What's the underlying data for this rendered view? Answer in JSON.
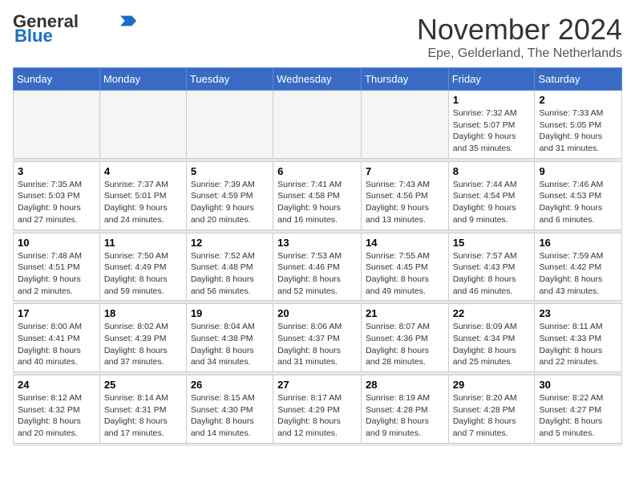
{
  "logo": {
    "line1": "General",
    "line2": "Blue"
  },
  "title": "November 2024",
  "subtitle": "Epe, Gelderland, The Netherlands",
  "weekdays": [
    "Sunday",
    "Monday",
    "Tuesday",
    "Wednesday",
    "Thursday",
    "Friday",
    "Saturday"
  ],
  "weeks": [
    [
      {
        "day": "",
        "info": ""
      },
      {
        "day": "",
        "info": ""
      },
      {
        "day": "",
        "info": ""
      },
      {
        "day": "",
        "info": ""
      },
      {
        "day": "",
        "info": ""
      },
      {
        "day": "1",
        "info": "Sunrise: 7:32 AM\nSunset: 5:07 PM\nDaylight: 9 hours and 35 minutes."
      },
      {
        "day": "2",
        "info": "Sunrise: 7:33 AM\nSunset: 5:05 PM\nDaylight: 9 hours and 31 minutes."
      }
    ],
    [
      {
        "day": "3",
        "info": "Sunrise: 7:35 AM\nSunset: 5:03 PM\nDaylight: 9 hours and 27 minutes."
      },
      {
        "day": "4",
        "info": "Sunrise: 7:37 AM\nSunset: 5:01 PM\nDaylight: 9 hours and 24 minutes."
      },
      {
        "day": "5",
        "info": "Sunrise: 7:39 AM\nSunset: 4:59 PM\nDaylight: 9 hours and 20 minutes."
      },
      {
        "day": "6",
        "info": "Sunrise: 7:41 AM\nSunset: 4:58 PM\nDaylight: 9 hours and 16 minutes."
      },
      {
        "day": "7",
        "info": "Sunrise: 7:43 AM\nSunset: 4:56 PM\nDaylight: 9 hours and 13 minutes."
      },
      {
        "day": "8",
        "info": "Sunrise: 7:44 AM\nSunset: 4:54 PM\nDaylight: 9 hours and 9 minutes."
      },
      {
        "day": "9",
        "info": "Sunrise: 7:46 AM\nSunset: 4:53 PM\nDaylight: 9 hours and 6 minutes."
      }
    ],
    [
      {
        "day": "10",
        "info": "Sunrise: 7:48 AM\nSunset: 4:51 PM\nDaylight: 9 hours and 2 minutes."
      },
      {
        "day": "11",
        "info": "Sunrise: 7:50 AM\nSunset: 4:49 PM\nDaylight: 8 hours and 59 minutes."
      },
      {
        "day": "12",
        "info": "Sunrise: 7:52 AM\nSunset: 4:48 PM\nDaylight: 8 hours and 56 minutes."
      },
      {
        "day": "13",
        "info": "Sunrise: 7:53 AM\nSunset: 4:46 PM\nDaylight: 8 hours and 52 minutes."
      },
      {
        "day": "14",
        "info": "Sunrise: 7:55 AM\nSunset: 4:45 PM\nDaylight: 8 hours and 49 minutes."
      },
      {
        "day": "15",
        "info": "Sunrise: 7:57 AM\nSunset: 4:43 PM\nDaylight: 8 hours and 46 minutes."
      },
      {
        "day": "16",
        "info": "Sunrise: 7:59 AM\nSunset: 4:42 PM\nDaylight: 8 hours and 43 minutes."
      }
    ],
    [
      {
        "day": "17",
        "info": "Sunrise: 8:00 AM\nSunset: 4:41 PM\nDaylight: 8 hours and 40 minutes."
      },
      {
        "day": "18",
        "info": "Sunrise: 8:02 AM\nSunset: 4:39 PM\nDaylight: 8 hours and 37 minutes."
      },
      {
        "day": "19",
        "info": "Sunrise: 8:04 AM\nSunset: 4:38 PM\nDaylight: 8 hours and 34 minutes."
      },
      {
        "day": "20",
        "info": "Sunrise: 8:06 AM\nSunset: 4:37 PM\nDaylight: 8 hours and 31 minutes."
      },
      {
        "day": "21",
        "info": "Sunrise: 8:07 AM\nSunset: 4:36 PM\nDaylight: 8 hours and 28 minutes."
      },
      {
        "day": "22",
        "info": "Sunrise: 8:09 AM\nSunset: 4:34 PM\nDaylight: 8 hours and 25 minutes."
      },
      {
        "day": "23",
        "info": "Sunrise: 8:11 AM\nSunset: 4:33 PM\nDaylight: 8 hours and 22 minutes."
      }
    ],
    [
      {
        "day": "24",
        "info": "Sunrise: 8:12 AM\nSunset: 4:32 PM\nDaylight: 8 hours and 20 minutes."
      },
      {
        "day": "25",
        "info": "Sunrise: 8:14 AM\nSunset: 4:31 PM\nDaylight: 8 hours and 17 minutes."
      },
      {
        "day": "26",
        "info": "Sunrise: 8:15 AM\nSunset: 4:30 PM\nDaylight: 8 hours and 14 minutes."
      },
      {
        "day": "27",
        "info": "Sunrise: 8:17 AM\nSunset: 4:29 PM\nDaylight: 8 hours and 12 minutes."
      },
      {
        "day": "28",
        "info": "Sunrise: 8:19 AM\nSunset: 4:28 PM\nDaylight: 8 hours and 9 minutes."
      },
      {
        "day": "29",
        "info": "Sunrise: 8:20 AM\nSunset: 4:28 PM\nDaylight: 8 hours and 7 minutes."
      },
      {
        "day": "30",
        "info": "Sunrise: 8:22 AM\nSunset: 4:27 PM\nDaylight: 8 hours and 5 minutes."
      }
    ]
  ]
}
